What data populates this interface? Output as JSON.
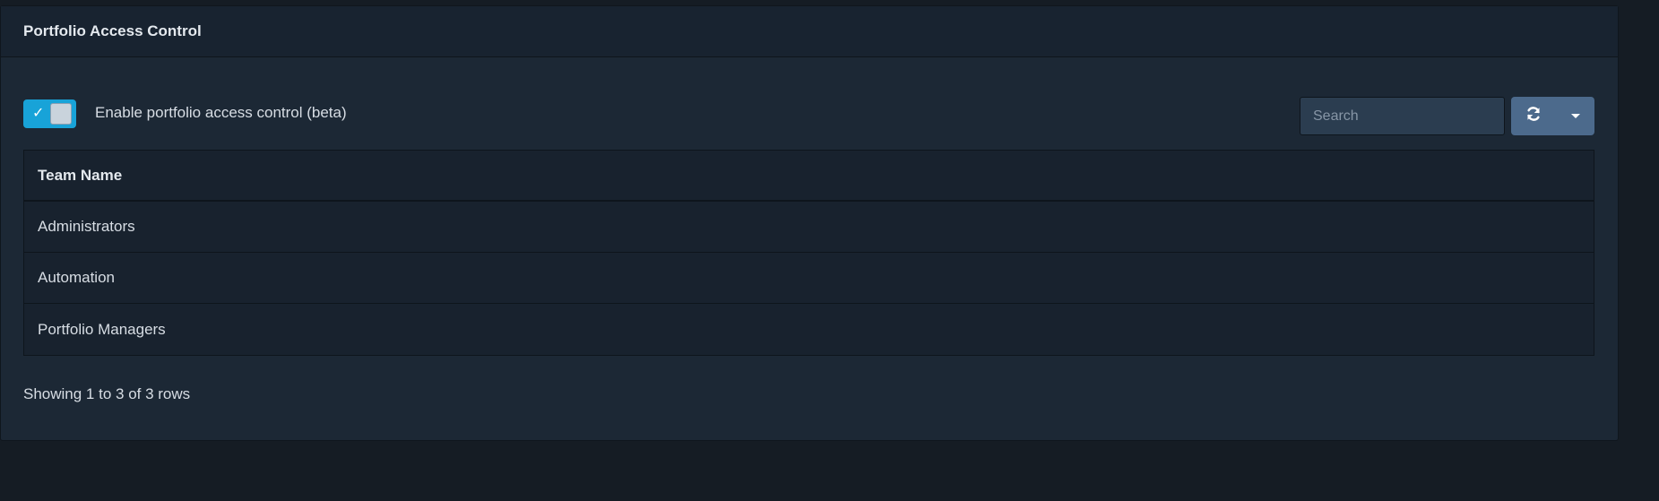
{
  "panel": {
    "title": "Portfolio Access Control"
  },
  "toggle": {
    "checked": true,
    "check_glyph": "✓",
    "label": "Enable portfolio access control (beta)"
  },
  "search": {
    "placeholder": "Search",
    "value": ""
  },
  "toolbar": {
    "refresh_icon": "refresh-icon",
    "dropdown_icon": "caret-down-icon"
  },
  "table": {
    "columns": [
      "Team Name"
    ],
    "rows": [
      {
        "team_name": "Administrators"
      },
      {
        "team_name": "Automation"
      },
      {
        "team_name": "Portfolio Managers"
      }
    ]
  },
  "pagination": {
    "info": "Showing 1 to 3 of 3 rows"
  },
  "colors": {
    "page_bg": "#151c24",
    "panel_bg": "#1c2835",
    "toggle_on": "#18a3d8",
    "button_bg": "#4c6a8c",
    "input_bg": "#2b3d50"
  }
}
